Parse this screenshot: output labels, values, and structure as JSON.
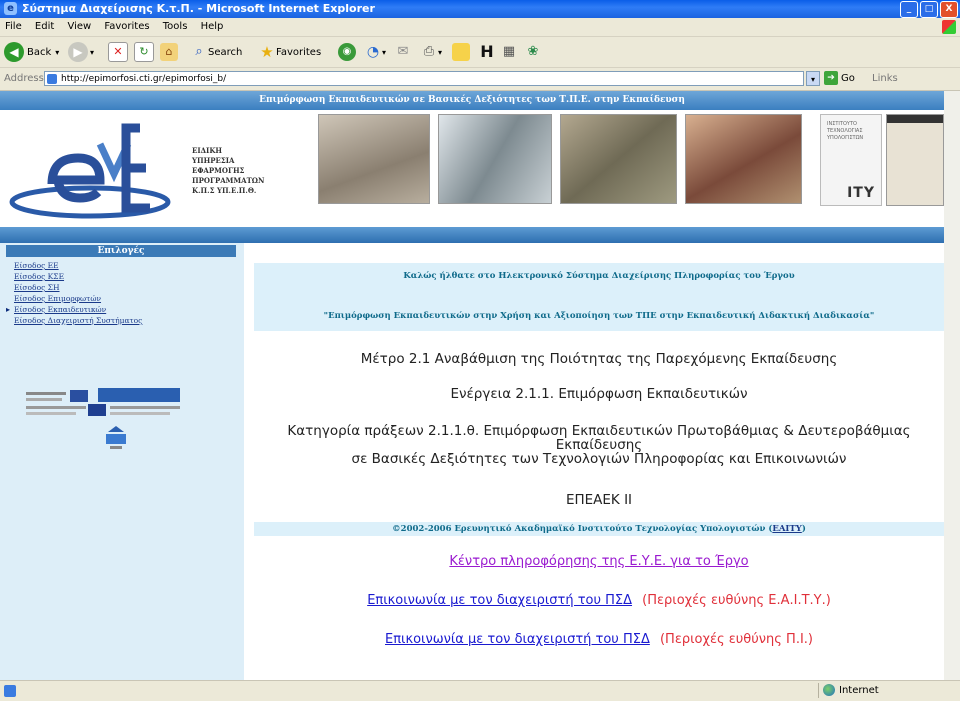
{
  "window": {
    "title": "Σύστημα Διαχείρισης Κ.τ.Π. - Microsoft Internet Explorer",
    "minimize_label": "_",
    "maximize_label": "□",
    "close_label": "X"
  },
  "menu": {
    "items": [
      "File",
      "Edit",
      "View",
      "Favorites",
      "Tools",
      "Help"
    ]
  },
  "toolbar": {
    "back_label": "Back",
    "search_label": "Search",
    "favorites_label": "Favorites"
  },
  "address": {
    "label": "Address",
    "url": "http://epimorfosi.cti.gr/epimorfosi_b/",
    "go_label": "Go",
    "links_label": "Links"
  },
  "banner": {
    "strip_text": "Επιμόρφωση Εκπαιδευτικών σε Βασικές Δεξιότητες των Τ.Π.Ε. στην Εκπαίδευση",
    "agency_lines": [
      "ΕΙΔΙΚΗ",
      "ΥΠΗΡΕΣΙΑ",
      "ΕΦΑΡΜΟΓΗΣ",
      "ΠΡΟΓΡΑΜΜΑΤΩΝ",
      "Κ.Π.Σ ΥΠ.Ε.Π.Θ."
    ],
    "ity_text": "ITY"
  },
  "sidebar": {
    "title": "Επιλογές",
    "items": [
      "Είσοδος ΕΕ",
      "Είσοδος ΚΣΕ",
      "Είσοδος ΣΗ",
      "Είσοδος Επιμορφωτών",
      "Είσοδος Εκπαιδευτικών",
      "Είσοδος Διαχειριστή Συστήματος"
    ]
  },
  "main": {
    "welcome_line1": "Καλώς ήλθατε στο Ηλεκτρονικό Σύστημα Διαχείρισης Πληροφορίας του Έργου",
    "welcome_line2": "\"Επιμόρφωση Εκπαιδευτικών στην Χρήση και Αξιοποίηση των ΤΠΕ στην Εκπαιδευτική Διδακτική Διαδικασία\"",
    "measure": "Μέτρο 2.1 Αναβάθμιση της Ποιότητας της Παρεχόμενης Εκπαίδευσης",
    "action": "Ενέργεια 2.1.1. Επιμόρφωση Εκπαιδευτικών",
    "category_line1": "Κατηγορία πράξεων 2.1.1.θ. Επιμόρφωση Εκπαιδευτικών Πρωτοβάθμιας & Δευτεροβάθμιας",
    "category_line2": "Εκπαίδευσης",
    "category_line3": "σε Βασικές Δεξιότητες των Τεχνολογιών Πληροφορίας και Επικοινωνιών",
    "program": "ΕΠΕΑΕΚ ΙΙ",
    "copyright_prefix": "©2002-2006 Ερευνητικό Ακαδημαϊκό Ινστιτούτο Τεχνολογίας Υπολογιστών (",
    "copyright_link": "ΕΑΙΤΥ",
    "copyright_suffix": ")",
    "info_link": "Κέντρο πληροφόρησης της Ε.Υ.Ε. για το Έργο",
    "contact1_link": "Επικοινωνία με τον διαχειριστή του ΠΣΔ",
    "contact1_note": "(Περιοχές ευθύνης Ε.Α.Ι.Τ.Υ.)",
    "contact2_link": "Επικοινωνία με τον διαχειριστή του ΠΣΔ",
    "contact2_note": "(Περιοχές ευθύνης Π.Ι.)"
  },
  "status": {
    "zone": "Internet"
  },
  "colors": {
    "link": "#1a1ad0",
    "visited_link": "#9a1ad0",
    "note": "#e0303a",
    "heading_teal": "#0e6a8a"
  }
}
